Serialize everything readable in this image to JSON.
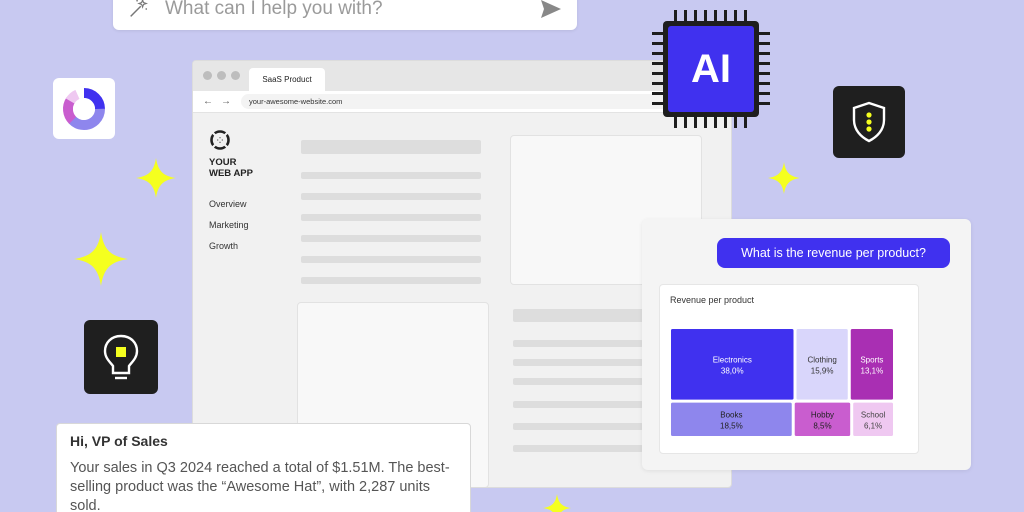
{
  "search": {
    "placeholder": "What can I help you with?"
  },
  "browser": {
    "tab_title": "SaaS Product",
    "url": "your-awesome-website.com",
    "app_name_line1": "YOUR",
    "app_name_line2": "WEB APP",
    "nav": [
      "Overview",
      "Marketing",
      "Growth"
    ]
  },
  "chip": {
    "label": "AI"
  },
  "chat": {
    "question": "What is the revenue per product?",
    "chart_title": "Revenue per product"
  },
  "chart_data": {
    "type": "treemap",
    "title": "Revenue per product",
    "items": [
      {
        "name": "Electronics",
        "label": "38,0%",
        "value": 38.0,
        "color": "#4031ef",
        "text": "#ffffff"
      },
      {
        "name": "Clothing",
        "label": "15,9%",
        "value": 15.9,
        "color": "#d9d6fb",
        "text": "#333333"
      },
      {
        "name": "Sports",
        "label": "13,1%",
        "value": 13.1,
        "color": "#a92fb3",
        "text": "#ffffff"
      },
      {
        "name": "Books",
        "label": "18,5%",
        "value": 18.5,
        "color": "#8e86ed",
        "text": "#222222"
      },
      {
        "name": "Hobby",
        "label": "8,5%",
        "value": 8.5,
        "color": "#c95dcf",
        "text": "#222222"
      },
      {
        "name": "School",
        "label": "6,1%",
        "value": 6.1,
        "color": "#efc8f1",
        "text": "#444444"
      }
    ]
  },
  "message": {
    "greeting": "Hi, VP of Sales",
    "body": "Your sales in Q3 2024 reached a total of $1.51M. The best-selling product was the “Awesome Hat”, with 2,287 units sold."
  },
  "colors": {
    "background": "#c8c9f1",
    "accent": "#4031ef",
    "highlight": "#f5ff1f"
  },
  "icons": [
    "magic-wand-icon",
    "send-icon",
    "ai-chip-icon",
    "donut-chart-icon",
    "shield-icon",
    "lightbulb-icon",
    "sparkle-icon"
  ]
}
